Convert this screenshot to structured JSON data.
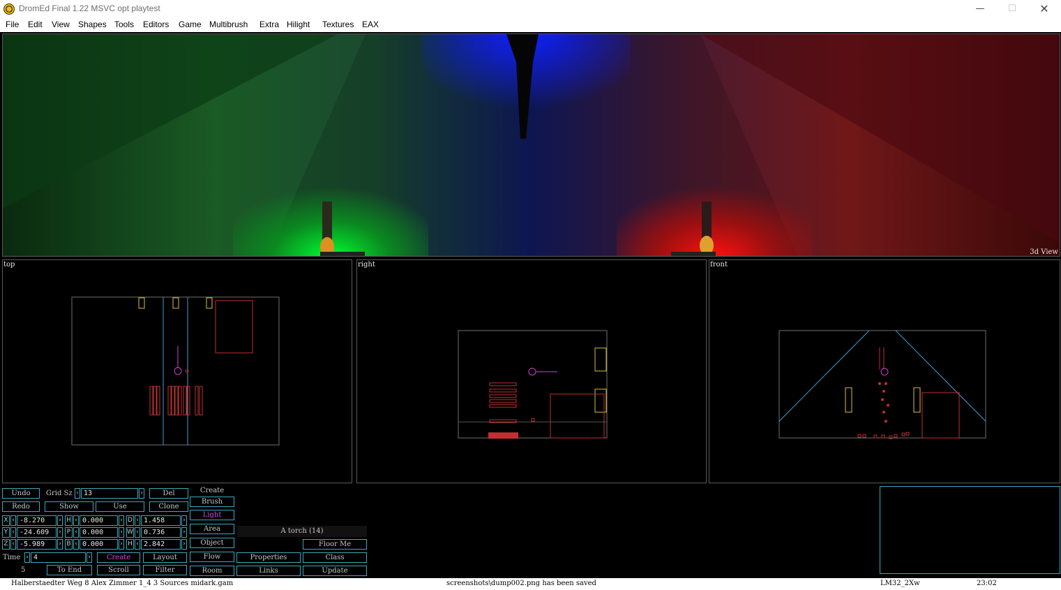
{
  "window": {
    "title": "DromEd Final 1.22 MSVC opt playtest",
    "minimize": "—",
    "maximize": "☐",
    "close": "✕"
  },
  "menu": [
    "File",
    "Edit",
    "View",
    "Shapes",
    "Tools",
    "Editors",
    "Game",
    "Multibrush",
    "Extra",
    "Hilight",
    "Textures",
    "EAX"
  ],
  "viewports": {
    "view3d_label": "3d View",
    "top_label": "top",
    "right_label": "right",
    "front_label": "front"
  },
  "controls": {
    "undo": "Undo",
    "redo": "Redo",
    "grid_label": "Grid Sz",
    "grid_value": "13",
    "show": "Show",
    "use": "Use",
    "del": "Del",
    "clone": "Clone",
    "x_label": "X",
    "x_value": "-8.270",
    "y_label": "Y",
    "y_value": "-24.609",
    "z_label": "Z",
    "z_value": "-5.989",
    "h_label": "H",
    "h_value": "0.000",
    "p_label": "P",
    "p_value": "0.000",
    "b_label": "B",
    "b_value": "0.000",
    "d_label": "D",
    "d_value": "1.458",
    "w_label": "W",
    "w_value": "0.736",
    "hh_label": "H",
    "hh_value": "2.842",
    "time_label": "Time",
    "time_value": "4",
    "frame_value": "5",
    "create": "Create",
    "layout": "Layout",
    "to_end": "To End",
    "scroll": "Scroll",
    "filter": "Filter",
    "mode_header": "Create",
    "brush": "Brush",
    "light": "Light",
    "area": "Area",
    "object": "Object",
    "flow": "Flow",
    "room": "Room",
    "properties": "Properties",
    "links": "Links",
    "object_name": "A torch (14)",
    "floor_me": "Floor Me",
    "class": "Class",
    "update": "Update"
  },
  "status": {
    "left": "Halberstaedter Weg 8 Alex Zimmer 1_4 3 Sources midark.gam",
    "center": "screenshots\\dump002.png has been saved",
    "mode": "LM32_2Xw",
    "time": "23:02"
  },
  "colors": {
    "accent": "#3aa9c0",
    "brush_red": "#c03030",
    "object_yellow": "#d8c040",
    "light_magenta": "#d040d0",
    "guide_blue": "#40a0d0"
  }
}
